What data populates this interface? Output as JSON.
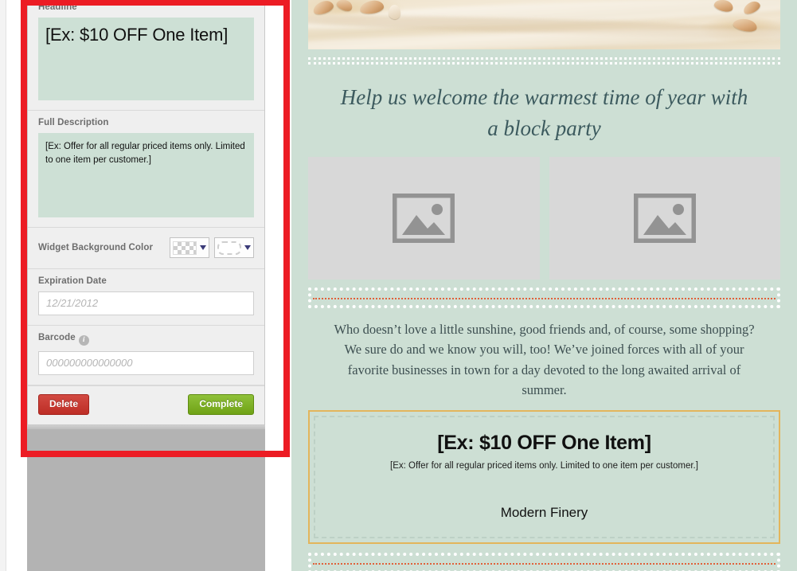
{
  "editor": {
    "headline": {
      "label": "Headline",
      "value": "[Ex: $10 OFF One Item]"
    },
    "description": {
      "label": "Full Description",
      "value": "[Ex: Offer for all regular priced items only. Limited to one item per customer.]"
    },
    "widget_background_color": {
      "label": "Widget Background Color",
      "swatch_primary": "transparent-checkerboard",
      "swatch_secondary": "dashed-outline",
      "caret_icon": "chevron-down-icon"
    },
    "expiration_date": {
      "label": "Expiration Date",
      "placeholder": "12/21/2012",
      "value": ""
    },
    "barcode": {
      "label": "Barcode",
      "placeholder": "000000000000000",
      "value": "",
      "info_icon": "info-icon",
      "info_glyph": "i"
    },
    "actions": {
      "delete_label": "Delete",
      "complete_label": "Complete"
    }
  },
  "annotation": {
    "color": "#ec1c24",
    "shape": "rectangle-highlight"
  },
  "preview": {
    "banner": {
      "alt": "sand-with-seashells-photo"
    },
    "headline": "Help us welcome the warmest time of year with a block party",
    "images": [
      {
        "alt": "image-placeholder",
        "icon": "picture-icon"
      },
      {
        "alt": "image-placeholder",
        "icon": "picture-icon"
      }
    ],
    "body": "Who doesn’t love a little sunshine, good friends and, of course, some shopping? We sure do and we know you will, too! We’ve joined forces with all of your favorite businesses in town for a day devoted to the long awaited arrival of summer.",
    "offer": {
      "headline": "[Ex: $10 OFF One Item]",
      "subtext": "[Ex: Offer for all regular priced items only. Limited to one item per customer.]",
      "business": "Modern Finery",
      "border_color": "#e3b55c"
    },
    "background_color": "#cddfd4",
    "dropzones": [
      "top-dropzone",
      "middle-dropzone",
      "bottom-dropzone"
    ]
  },
  "colors": {
    "green_field": "#cde0d5",
    "delete_red": "#bd2d25",
    "complete_green": "#7ab317",
    "annotation_red": "#ec1c24"
  }
}
